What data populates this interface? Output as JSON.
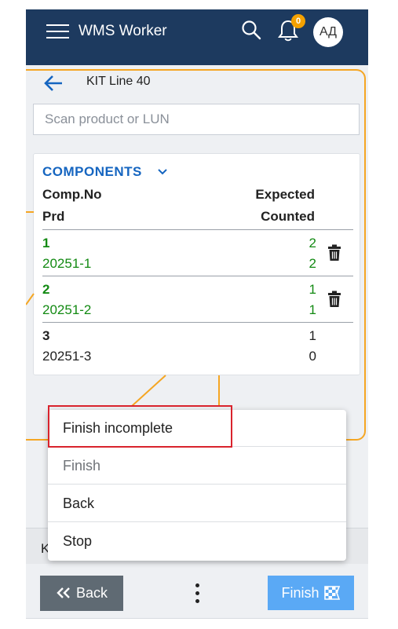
{
  "app": {
    "title": "WMS Worker",
    "avatar_initials": "АД",
    "notifications_count": "0"
  },
  "page": {
    "title": "KIT Line 40"
  },
  "scan": {
    "placeholder": "Scan product or LUN",
    "value": ""
  },
  "components": {
    "title": "COMPONENTS",
    "headers": {
      "comp_no": "Comp.No",
      "expected": "Expected",
      "prd": "Prd",
      "counted": "Counted"
    },
    "rows": [
      {
        "comp_no": "1",
        "prd": "20251-1",
        "expected": "2",
        "counted": "2",
        "complete": true
      },
      {
        "comp_no": "2",
        "prd": "20251-2",
        "expected": "1",
        "counted": "1",
        "complete": true
      },
      {
        "comp_no": "3",
        "prd": "20251-3",
        "expected": "1",
        "counted": "0",
        "complete": false
      }
    ]
  },
  "menu": {
    "items": [
      {
        "label": "Finish incomplete",
        "disabled": false
      },
      {
        "label": "Finish",
        "disabled": true
      },
      {
        "label": "Back",
        "disabled": false
      },
      {
        "label": "Stop",
        "disabled": false
      }
    ]
  },
  "bottom_strip": {
    "text": "K"
  },
  "footer": {
    "back_label": "Back",
    "finish_label": "Finish"
  },
  "colors": {
    "header": "#1d3a5f",
    "accent": "#1565c0",
    "complete": "#138a13",
    "badge": "#f4a100",
    "finish_button": "#5aa9f5",
    "back_button": "#5f6a73",
    "highlight": "#d9232d",
    "overlay_line": "#f5a623"
  }
}
